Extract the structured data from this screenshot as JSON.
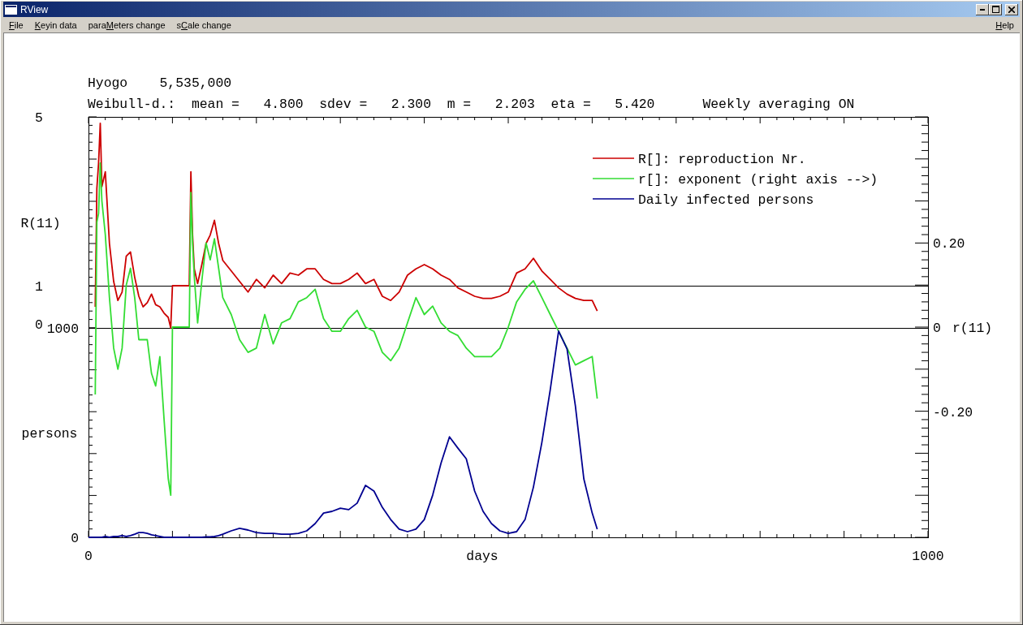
{
  "window": {
    "title": "RView"
  },
  "menu": [
    {
      "key": "F",
      "after": "ile"
    },
    {
      "key": "K",
      "after": "eyin data"
    },
    {
      "before": "para",
      "key": "M",
      "after": "eters change"
    },
    {
      "before": "s",
      "key": "C",
      "after": "ale change"
    }
  ],
  "help_menu": {
    "key": "H",
    "after": "elp"
  },
  "chart": {
    "region": "Hyogo",
    "population": "5,535,000",
    "distribution": "Weibull-d.:",
    "parameters": [
      {
        "label": "mean =",
        "value": "4.800"
      },
      {
        "label": "sdev =",
        "value": "2.300"
      },
      {
        "label": "m =",
        "value": "2.203"
      },
      {
        "label": "eta =",
        "value": "5.420"
      }
    ],
    "averaging": "Weekly averaging ON",
    "ratio_plot": {
      "chart_data": {
        "type": "line",
        "ylabel": "R(11)",
        "ylim": [
          0,
          5
        ],
        "yticks": [
          {
            "value": 5,
            "label": "5"
          },
          {
            "value": 1,
            "label": "1"
          },
          {
            "value": 0,
            "label": "0"
          }
        ],
        "xlim": [
          0,
          1000
        ],
        "x": [
          8,
          10,
          12,
          14,
          16,
          20,
          25,
          30,
          35,
          40,
          45,
          50,
          55,
          60,
          65,
          70,
          75,
          80,
          85,
          90,
          95,
          98,
          100,
          110,
          120,
          122,
          124,
          126,
          130,
          135,
          140,
          145,
          150,
          155,
          160,
          170,
          180,
          190,
          200,
          210,
          220,
          230,
          240,
          250,
          260,
          270,
          280,
          290,
          300,
          310,
          320,
          330,
          340,
          350,
          360,
          370,
          380,
          390,
          400,
          410,
          420,
          430,
          440,
          450,
          460,
          470,
          480,
          490,
          500,
          510,
          520,
          530,
          540,
          550,
          560,
          570,
          580,
          590,
          600,
          606
        ],
        "series": [
          {
            "name": "R[]: reproduction Nr.",
            "color": "#cc0000",
            "values": [
              0.5,
              3.3,
              3.9,
              4.85,
              3.35,
              3.7,
              2.0,
              1.1,
              0.65,
              0.85,
              1.7,
              1.8,
              1.2,
              0.75,
              0.5,
              0.6,
              0.8,
              0.55,
              0.5,
              0.35,
              0.25,
              0,
              1.0,
              1.0,
              1.0,
              3.7,
              2.2,
              1.4,
              1.05,
              1.5,
              2.0,
              2.2,
              2.55,
              2.0,
              1.6,
              1.35,
              1.1,
              0.85,
              1.15,
              0.95,
              1.25,
              1.05,
              1.3,
              1.25,
              1.4,
              1.4,
              1.15,
              1.05,
              1.05,
              1.15,
              1.3,
              1.05,
              1.15,
              0.75,
              0.65,
              0.85,
              1.25,
              1.4,
              1.5,
              1.4,
              1.25,
              1.15,
              0.95,
              0.85,
              0.75,
              0.7,
              0.7,
              0.75,
              0.85,
              1.3,
              1.4,
              1.65,
              1.35,
              1.15,
              0.95,
              0.8,
              0.7,
              0.65,
              0.65,
              0.4
            ]
          }
        ]
      }
    },
    "exponent_plot": {
      "chart_data": {
        "type": "line",
        "ylabel": "r(11)",
        "ylim": [
          -0.5,
          0.5
        ],
        "yticks": [
          {
            "value": 0.2,
            "label": "0.20"
          },
          {
            "value": 0,
            "label": "0"
          },
          {
            "value": -0.2,
            "label": "-0.20"
          }
        ],
        "xlim": [
          0,
          1000
        ],
        "x": [
          8,
          10,
          12,
          14,
          16,
          20,
          25,
          30,
          35,
          40,
          45,
          50,
          55,
          60,
          65,
          70,
          75,
          80,
          85,
          90,
          95,
          98,
          100,
          110,
          120,
          122,
          124,
          126,
          130,
          135,
          140,
          145,
          150,
          155,
          160,
          170,
          180,
          190,
          200,
          210,
          220,
          230,
          240,
          250,
          260,
          270,
          280,
          290,
          300,
          310,
          320,
          330,
          340,
          350,
          360,
          370,
          380,
          390,
          400,
          410,
          420,
          430,
          440,
          450,
          460,
          470,
          480,
          490,
          500,
          510,
          520,
          530,
          540,
          550,
          560,
          570,
          580,
          590,
          600,
          606
        ],
        "series": [
          {
            "name": "r[]: exponent (right axis -->)",
            "color": "#33dd33",
            "values": [
              -0.16,
              0.25,
              0.27,
              0.39,
              0.3,
              0.22,
              0.07,
              -0.05,
              -0.1,
              -0.05,
              0.1,
              0.14,
              0.07,
              -0.03,
              -0.03,
              -0.03,
              -0.11,
              -0.14,
              -0.07,
              -0.22,
              -0.36,
              -0.4,
              0,
              0,
              0,
              0.32,
              0.2,
              0.12,
              0.01,
              0.11,
              0.2,
              0.16,
              0.21,
              0.14,
              0.07,
              0.03,
              -0.03,
              -0.06,
              -0.05,
              0.03,
              -0.04,
              0.01,
              0.02,
              0.06,
              0.07,
              0.09,
              0.02,
              -0.01,
              -0.01,
              0.02,
              0.04,
              0,
              -0.01,
              -0.06,
              -0.08,
              -0.05,
              0.01,
              0.07,
              0.03,
              0.05,
              0.01,
              -0.01,
              -0.02,
              -0.05,
              -0.07,
              -0.07,
              -0.07,
              -0.05,
              0,
              0.06,
              0.09,
              0.11,
              0.07,
              0.03,
              -0.01,
              -0.05,
              -0.09,
              -0.08,
              -0.07,
              -0.17
            ]
          }
        ]
      }
    },
    "count_plot": {
      "chart_data": {
        "type": "line",
        "xlabel": "days",
        "ylabel": "persons",
        "ylim": [
          0,
          1000
        ],
        "yticks": [
          {
            "value": 1000,
            "label": "1000"
          },
          {
            "value": 0,
            "label": "0"
          }
        ],
        "xlim": [
          0,
          1000
        ],
        "xticks": [
          0,
          1000
        ],
        "x": [
          0,
          8,
          10,
          12,
          14,
          16,
          20,
          25,
          30,
          35,
          40,
          45,
          50,
          55,
          60,
          65,
          70,
          75,
          80,
          85,
          90,
          95,
          98,
          100,
          110,
          120,
          122,
          124,
          126,
          130,
          135,
          140,
          145,
          150,
          155,
          160,
          170,
          180,
          190,
          200,
          210,
          220,
          230,
          240,
          250,
          260,
          270,
          280,
          290,
          300,
          310,
          320,
          330,
          340,
          350,
          360,
          370,
          380,
          390,
          400,
          410,
          420,
          430,
          440,
          450,
          460,
          470,
          480,
          490,
          500,
          510,
          520,
          530,
          540,
          550,
          560,
          570,
          580,
          590,
          600,
          606
        ],
        "series": [
          {
            "name": "Daily infected persons",
            "color": "#000090",
            "values": [
              0,
              0,
              0,
              0,
              0,
              0,
              4,
              0,
              4,
              4,
              8,
              4,
              8,
              15,
              23,
              23,
              19,
              12,
              8,
              4,
              0,
              0,
              0,
              0,
              0,
              0,
              0,
              0,
              0,
              0,
              0,
              2,
              2,
              4,
              8,
              15,
              31,
              43,
              35,
              23,
              19,
              19,
              15,
              15,
              19,
              31,
              66,
              116,
              124,
              139,
              132,
              163,
              248,
              221,
              143,
              85,
              39,
              27,
              39,
              85,
              201,
              356,
              480,
              426,
              375,
              221,
              124,
              66,
              31,
              19,
              27,
              85,
              240,
              453,
              704,
              985,
              900,
              627,
              279,
              116,
              39
            ]
          }
        ]
      }
    }
  }
}
